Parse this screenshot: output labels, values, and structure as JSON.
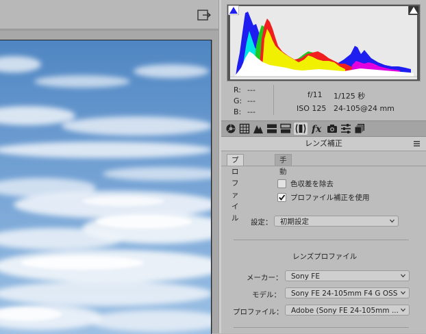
{
  "toolbar": {
    "exit_icon": "exit-fullscreen-icon"
  },
  "histogram": {
    "shadow_clip_icon": "shadow-clipping-warning-icon",
    "highlight_clip_icon": "highlight-clipping-warning-icon",
    "colors": {
      "blue": "#1e1ef0",
      "cyan": "#00e6e6",
      "green": "#22c822",
      "yellow": "#f0f000",
      "red": "#f01e1e",
      "magenta": "#e000e0",
      "white": "#ffffff"
    }
  },
  "readout": {
    "r_label": "R:",
    "r_value": "---",
    "g_label": "G:",
    "g_value": "---",
    "b_label": "B:",
    "b_value": "---",
    "aperture": "f/11",
    "shutter": "1/125 秒",
    "iso": "ISO 125",
    "lens": "24-105@24 mm"
  },
  "tools": [
    "basic-icon",
    "tone-curve-icon",
    "detail-icon",
    "hsl-icon",
    "split-toning-icon",
    "lens-corrections-icon",
    "effects-icon",
    "camera-calibration-icon",
    "presets-icon",
    "snapshots-icon"
  ],
  "panel": {
    "title": "レンズ補正",
    "menu_icon": "panel-menu-icon",
    "tabs": [
      {
        "label": "プロファイル"
      },
      {
        "label": "手動"
      }
    ],
    "remove_ca_label": "色収差を除去",
    "remove_ca_checked": false,
    "use_profile_label": "プロファイル補正を使用",
    "use_profile_checked": true,
    "setup_label": "設定：",
    "setup_value": "初期設定",
    "lens_profile_heading": "レンズプロファイル",
    "make_label": "メーカー：",
    "make_value": "Sony FE",
    "model_label": "モデル：",
    "model_value": "Sony FE 24-105mm F4 G OSS",
    "profile_label": "プロファイル：",
    "profile_value": "Adobe (Sony FE 24-105mm ..."
  }
}
